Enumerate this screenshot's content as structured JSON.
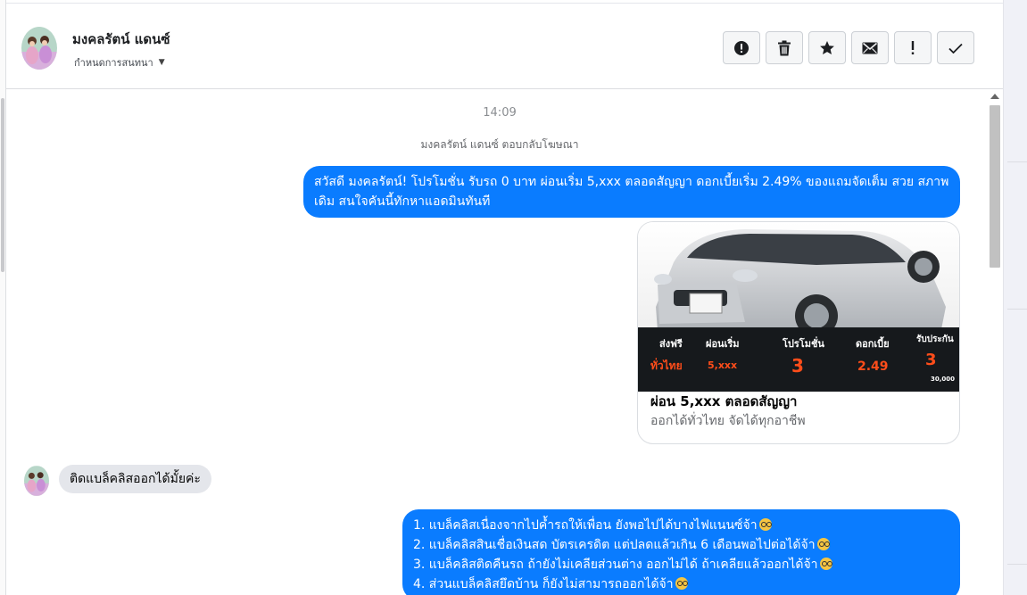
{
  "header": {
    "contact_name": "มงคลรัตน์ แดนซ์",
    "conversation_settings_label": "กำหนดการสนทนา",
    "toolbar": [
      {
        "name": "report-button",
        "icon": "exclamation-circle-icon"
      },
      {
        "name": "delete-button",
        "icon": "trash-icon"
      },
      {
        "name": "star-button",
        "icon": "star-icon"
      },
      {
        "name": "mark-unread-button",
        "icon": "envelope-icon"
      },
      {
        "name": "flag-spam-button",
        "icon": "exclamation-icon"
      },
      {
        "name": "mark-done-button",
        "icon": "check-icon"
      }
    ]
  },
  "chat": {
    "timestamp": "14:09",
    "reply_note": "มงคลรัตน์ แดนซ์ ตอบกลับโฆษณา",
    "messages": {
      "outgoing_1": "สวัสดี มงคลรัตน์! โปรโมชั่น รับรถ 0 บาท ผ่อนเริ่ม 5,xxx ตลอดสัญญา ดอกเบี้ยเริ่ม 2.49% ของแถมจัดเต็ม สวย สภาพเดิม สนใจคันนี้ทักหาแอดมินทันที",
      "ad_card": {
        "title": "ผ่อน 5,xxx ตลอดสัญญา",
        "subtitle": "ออกได้ทั่วไทย จัดได้ทุกอาชีพ",
        "banner": {
          "col1_label": "ส่งฟรี",
          "col1_value": "ทั่วไทย",
          "col2_label": "ผ่อนเริ่ม",
          "col2_value": "5,xxx",
          "col3_label": "โปรโมชั่น",
          "col3_value": "3",
          "col4_label": "ดอกเบี้ย",
          "col4_value": "2.49",
          "col5_label": "รับประกัน",
          "col5_value": "3",
          "col5_note": "30,000"
        }
      },
      "incoming_1": "ติดแบล็คลิสออกได้มั้ยค่ะ",
      "outgoing_2": [
        "1. แบล็คลิสเนื่องจากไปค้ำรถให้เพื่อน ยังพอไปได้บางไฟแนนซ์จ้า",
        "2. แบล็คลิสสินเชื่อเงินสด บัตรเครดิต แต่ปลดแล้วเกิน 6 เดือนพอไปต่อได้จ้า",
        "3. แบล็คลิสติดคืนรถ ถ้ายังไม่เคลียส่วนต่าง ออกไม่ได้ ถ้าเคลียแล้วออกได้จ้า",
        "4. ส่วนแบล็คลิสยึดบ้าน ก็ยังไม่สามารถออกได้จ้า"
      ]
    }
  },
  "colors": {
    "outgoing_bubble": "#0a7cff",
    "incoming_bubble": "#e4e6eb",
    "banner_accent": "#ff4d1a"
  }
}
